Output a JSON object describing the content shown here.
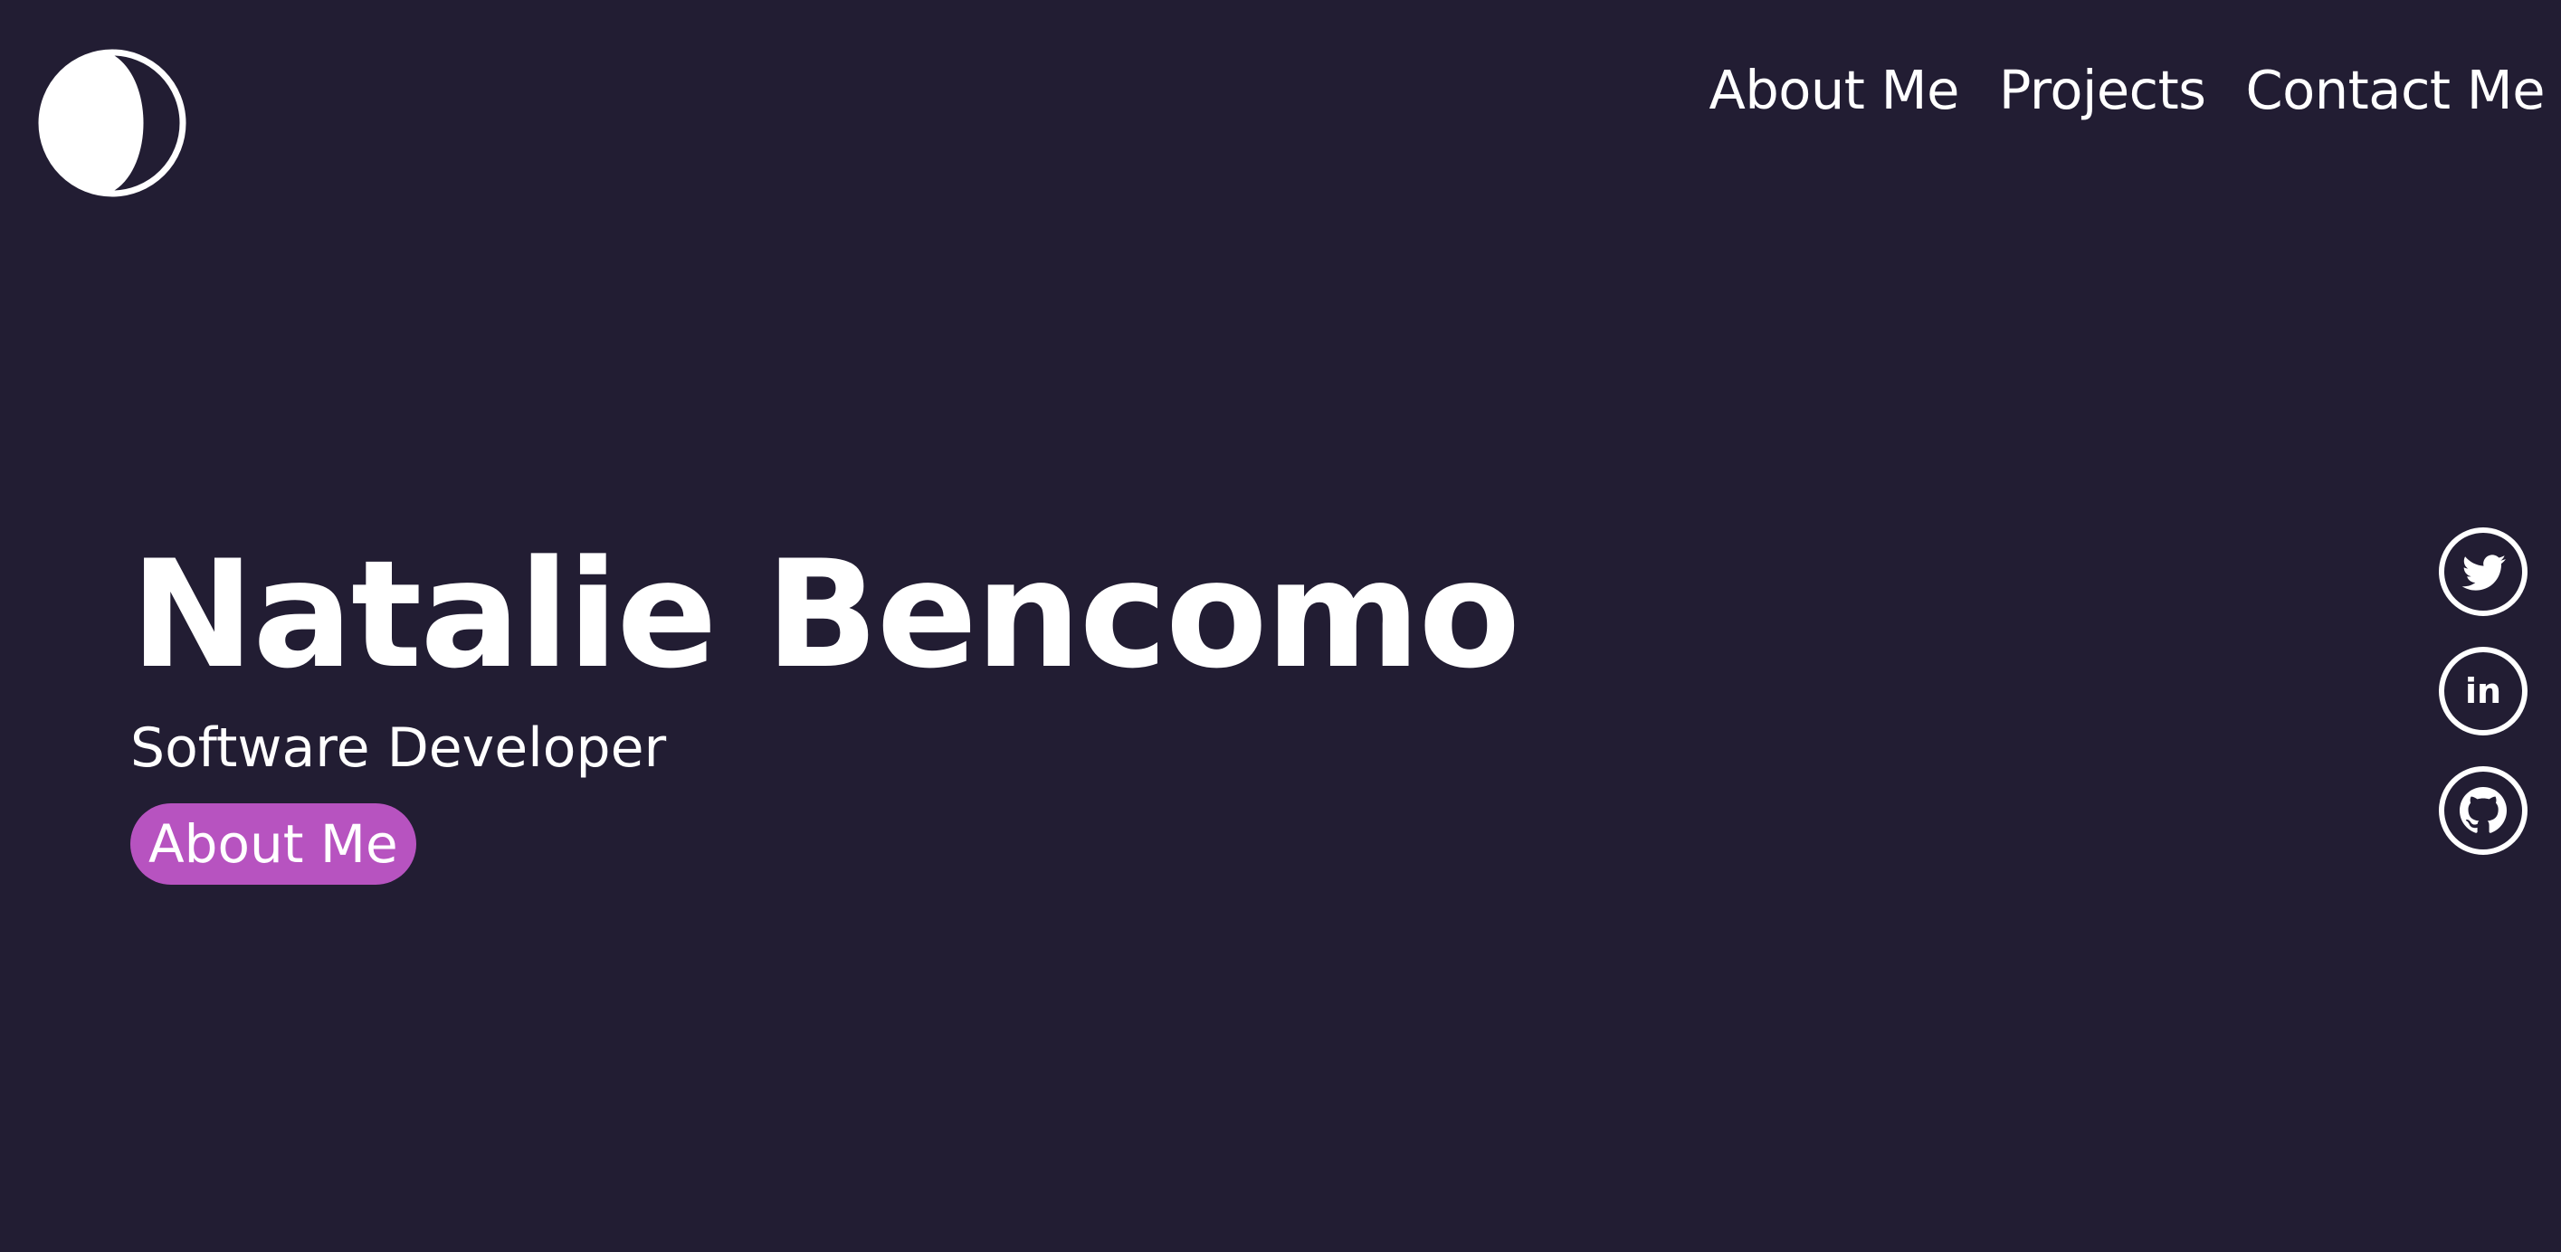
{
  "header": {
    "logo_icon": "crescent-moon-icon",
    "nav": [
      {
        "label": "About Me"
      },
      {
        "label": "Projects"
      },
      {
        "label": "Contact Me"
      }
    ]
  },
  "hero": {
    "name": "Natalie Bencomo",
    "role": "Software Developer",
    "button_label": "About Me"
  },
  "social": [
    {
      "icon": "twitter-icon"
    },
    {
      "icon": "linkedin-icon",
      "glyph": "in"
    },
    {
      "icon": "github-icon"
    }
  ],
  "colors": {
    "background": "#221d33",
    "text": "#ffffff",
    "accent": "#b753c0"
  }
}
